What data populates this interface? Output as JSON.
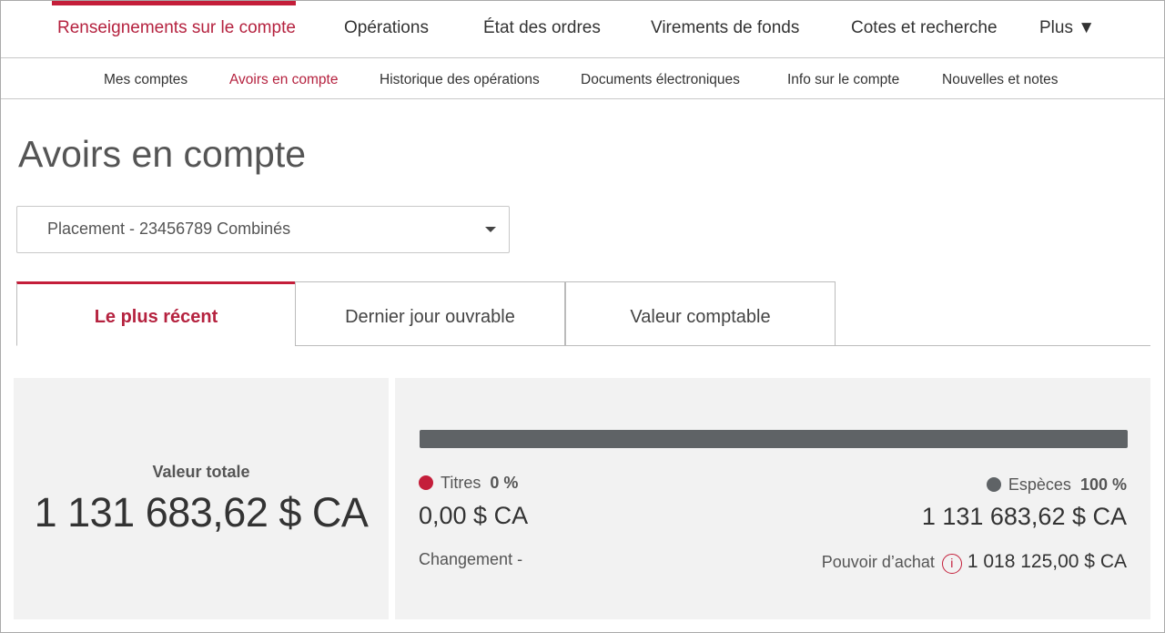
{
  "top_nav": {
    "items": [
      "Renseignements sur le compte",
      "Opérations",
      "État des ordres",
      "Virements de fonds",
      "Cotes et recherche",
      "Plus ▼"
    ],
    "active": 0
  },
  "sub_nav": {
    "items": [
      "Mes comptes",
      "Avoirs en compte",
      "Historique des opérations",
      "Documents électroniques",
      "Info sur le compte",
      "Nouvelles et notes"
    ],
    "active": 1
  },
  "page_title": "Avoirs en compte",
  "account_select": {
    "value": "Placement - 23456789 Combinés"
  },
  "tabs": [
    "Le plus récent",
    "Dernier jour ouvrable",
    "Valeur comptable"
  ],
  "summary": {
    "total_label": "Valeur totale",
    "total_value": "1 131 683,62 $ CA"
  },
  "allocation": {
    "bar_percent_especes": 100,
    "titres": {
      "label": "Titres",
      "percent": "0 %",
      "value": "0,00 $ CA",
      "color": "#c41e3a"
    },
    "especes": {
      "label": "Espèces",
      "percent": "100 %",
      "value": "1 131 683,62 $ CA",
      "color": "#5f6366"
    },
    "change_label": "Changement -",
    "buying_power_label": "Pouvoir d’achat",
    "buying_power_value": "1 018 125,00 $ CA",
    "info_icon": "i"
  },
  "colors": {
    "accent": "#c41e3a"
  }
}
